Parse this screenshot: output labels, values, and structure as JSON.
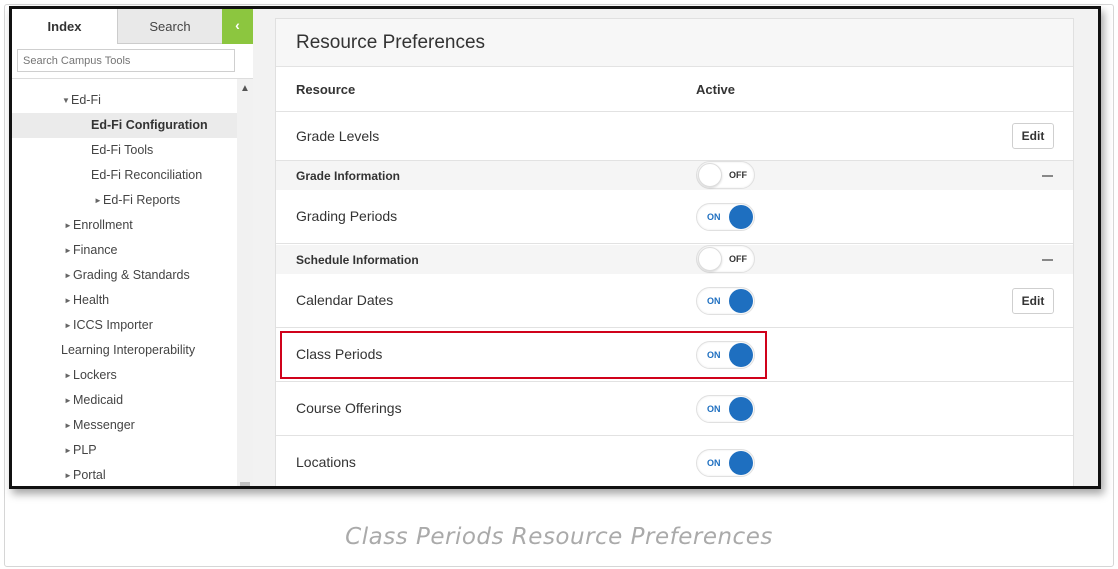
{
  "sidebar": {
    "tabs": {
      "index": "Index",
      "search": "Search"
    },
    "collapse_icon": "chevron-left-icon",
    "search_placeholder": "Search Campus Tools",
    "items": [
      {
        "label": "Ed-Fi"
      },
      {
        "label": "Ed-Fi Configuration"
      },
      {
        "label": "Ed-Fi Tools"
      },
      {
        "label": "Ed-Fi Reconciliation"
      },
      {
        "label": "Ed-Fi Reports"
      },
      {
        "label": "Enrollment"
      },
      {
        "label": "Finance"
      },
      {
        "label": "Grading & Standards"
      },
      {
        "label": "Health"
      },
      {
        "label": "ICCS Importer"
      },
      {
        "label": "Learning Interoperability"
      },
      {
        "label": "Lockers"
      },
      {
        "label": "Medicaid"
      },
      {
        "label": "Messenger"
      },
      {
        "label": "PLP"
      },
      {
        "label": "Portal"
      }
    ]
  },
  "panel": {
    "title": "Resource Preferences",
    "col_resource": "Resource",
    "col_active": "Active",
    "rows": [
      {
        "label": "Grade Levels",
        "edit": "Edit"
      },
      {
        "group": "Grade Information",
        "toggle": "OFF"
      },
      {
        "label": "Grading Periods",
        "toggle": "ON"
      },
      {
        "group": "Schedule Information",
        "toggle": "OFF"
      },
      {
        "label": "Calendar Dates",
        "toggle": "ON",
        "edit": "Edit"
      },
      {
        "label": "Class Periods",
        "toggle": "ON"
      },
      {
        "label": "Course Offerings",
        "toggle": "ON"
      },
      {
        "label": "Locations",
        "toggle": "ON"
      }
    ]
  },
  "colors": {
    "accent_green": "#8cc63f",
    "toggle_blue": "#1e6fc0",
    "highlight_red": "#d0021b"
  },
  "caption": "Class Periods Resource Preferences"
}
